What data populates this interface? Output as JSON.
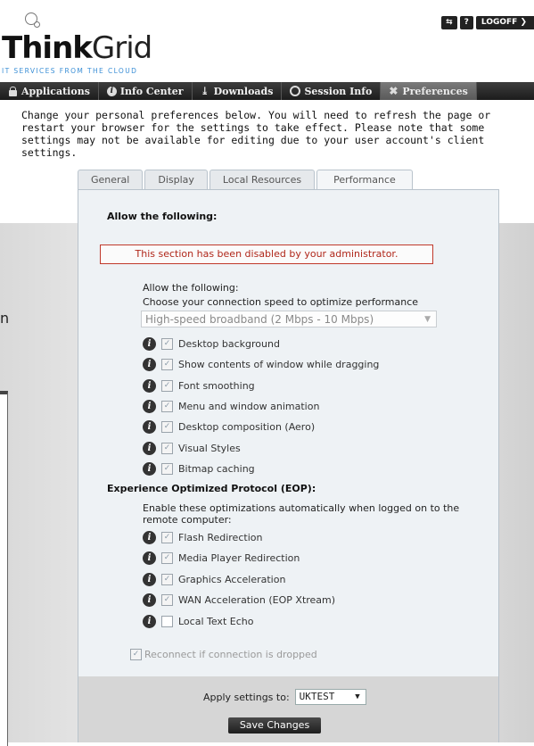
{
  "header": {
    "logo_bold": "Th",
    "logo_bold2": "nk",
    "logo_thin": "Grid",
    "logo_i": "i",
    "tagline": "IT SERVICES FROM THE CLOUD",
    "buttons": [
      "⇆",
      "?",
      "LOGOFF",
      "❯"
    ]
  },
  "nav": {
    "items": [
      {
        "label": "Applications",
        "icon": "lock-icon"
      },
      {
        "label": "Info Center",
        "icon": "info-icon"
      },
      {
        "label": "Downloads",
        "icon": "download-icon"
      },
      {
        "label": "Session Info",
        "icon": "session-icon"
      },
      {
        "label": "Preferences",
        "icon": "preferences-icon",
        "active": true
      }
    ]
  },
  "intro": {
    "text": "Change your personal preferences below. You will need to refresh the page or restart your browser for the settings to take effect. Please note that some settings may not be available for editing due to your user account's client settings."
  },
  "tabs": [
    "General",
    "Display",
    "Local Resources",
    "Performance"
  ],
  "performance": {
    "allow_title": "Allow the following:",
    "disabled_notice": "This section has been disabled by your administrator.",
    "allow_sub": "Allow the following:",
    "speed_label": "Choose your connection speed to optimize performance",
    "speed_value": "High-speed broadband (2 Mbps - 10 Mbps)",
    "options": [
      {
        "label": "Desktop background",
        "checked": true
      },
      {
        "label": "Show contents of window while dragging",
        "checked": true
      },
      {
        "label": "Font smoothing",
        "checked": true
      },
      {
        "label": "Menu and window animation",
        "checked": true
      },
      {
        "label": "Desktop composition (Aero)",
        "checked": true
      },
      {
        "label": "Visual Styles",
        "checked": true
      },
      {
        "label": "Bitmap caching",
        "checked": true
      }
    ],
    "eop_title": "Experience Optimized Protocol (EOP):",
    "eop_desc_1": "Enable these optimizations automatically when logged on to the",
    "eop_desc_2": "remote computer:",
    "eop_options": [
      {
        "label": "Flash Redirection",
        "checked": true
      },
      {
        "label": "Media Player Redirection",
        "checked": true
      },
      {
        "label": "Graphics Acceleration",
        "checked": true
      },
      {
        "label": "WAN Acceleration (EOP Xtream)",
        "checked": true
      },
      {
        "label": "Local Text Echo",
        "checked": false
      }
    ],
    "reconnect": "Reconnect if connection is dropped"
  },
  "footer": {
    "apply_label": "Apply settings to:",
    "apply_value": "UKTEST",
    "save_label": "Save Changes"
  },
  "background": {
    "glyph": "n"
  }
}
